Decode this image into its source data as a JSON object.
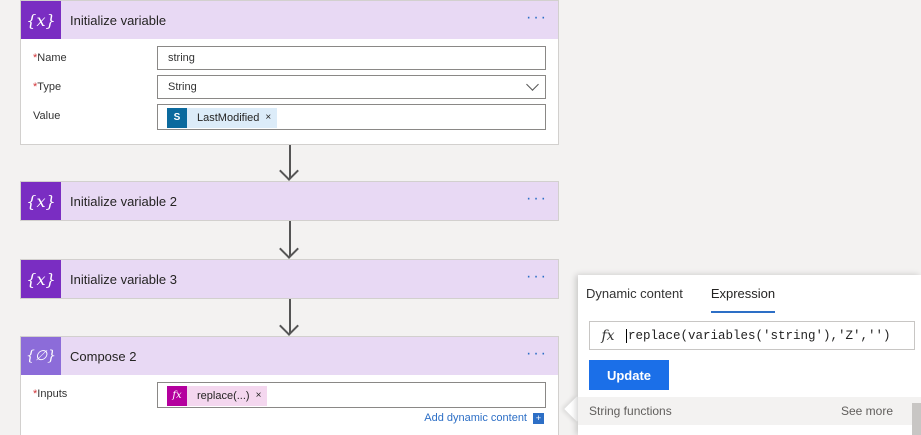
{
  "cards": [
    {
      "title": "Initialize variable",
      "icon": "{x}"
    },
    {
      "title": "Initialize variable 2",
      "icon": "{x}"
    },
    {
      "title": "Initialize variable 3",
      "icon": "{x}"
    },
    {
      "title": "Compose 2",
      "icon": "{∅}"
    }
  ],
  "more_label": "···",
  "init_var": {
    "name_label": "Name",
    "name_value": "string",
    "type_label": "Type",
    "type_value": "String",
    "value_label": "Value",
    "value_token": "LastModified",
    "value_token_icon": "S",
    "remove": "×"
  },
  "required_mark": "*",
  "compose": {
    "inputs_label": "Inputs",
    "inputs_token": "replace(...)",
    "token_icon": "fx",
    "remove": "×",
    "add_dynamic": "Add dynamic content",
    "add_dynamic_icon": "+"
  },
  "panel": {
    "tabs": [
      "Dynamic content",
      "Expression"
    ],
    "active_tab": "Expression",
    "fx": "fx",
    "expression": "replace(variables('string'),'Z','')",
    "update_label": "Update",
    "section": "String functions",
    "see_more": "See more"
  },
  "colors": {
    "header_bg": "#e8d9f4",
    "variable_icon": "#7a2dc2",
    "compose_icon": "#8c6cd9",
    "accent": "#2d6fc6",
    "update_button": "#1b6fe8"
  }
}
